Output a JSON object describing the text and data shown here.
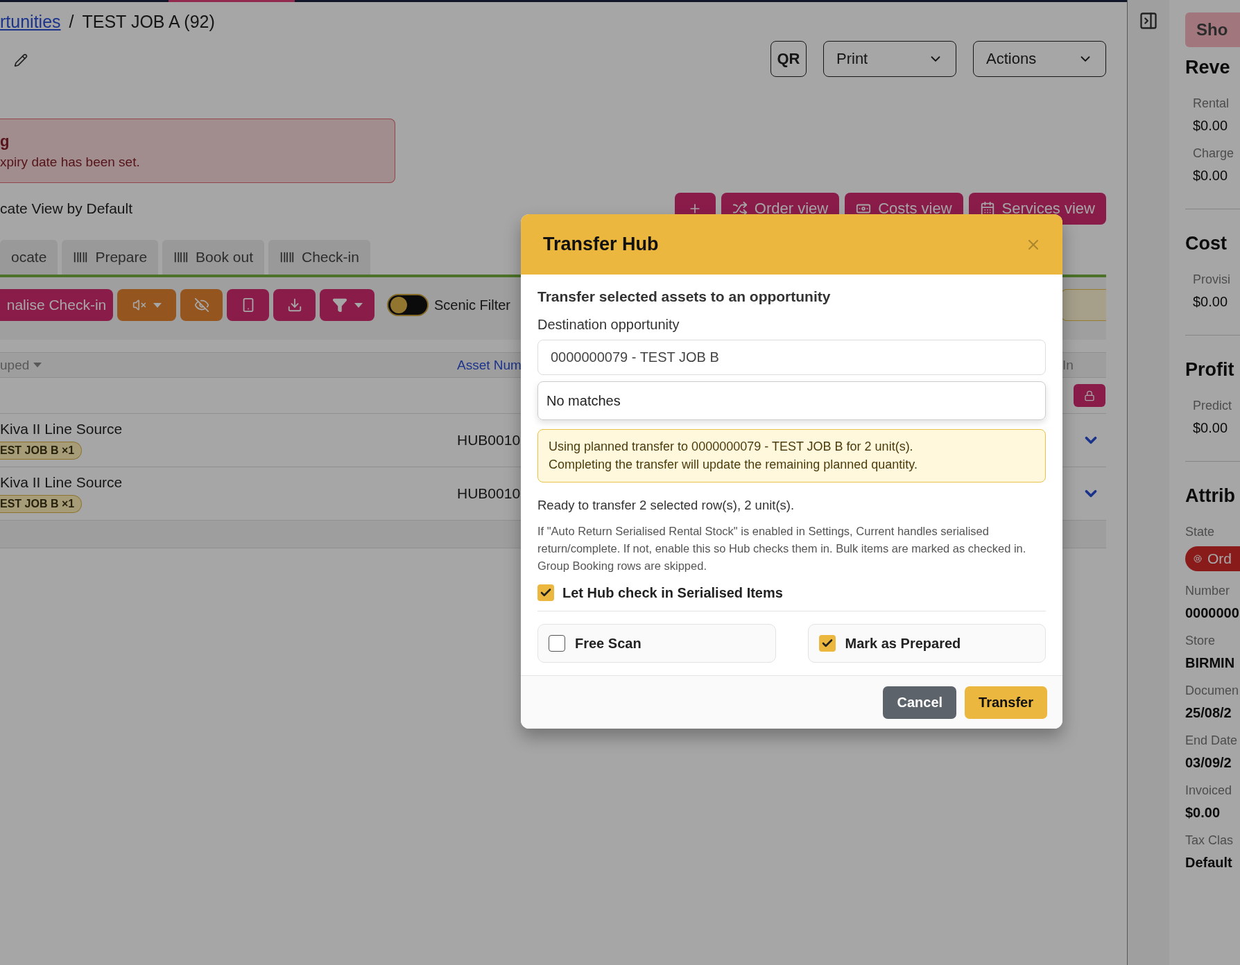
{
  "breadcrumb": {
    "link": "rtunities",
    "separator": "/",
    "current": "TEST JOB A (92)"
  },
  "header_actions": [
    {
      "label": "QR",
      "kind": "plain"
    },
    {
      "label": "Print",
      "kind": "dropdown"
    },
    {
      "label": "Actions",
      "kind": "dropdown"
    }
  ],
  "alert": {
    "title": "g",
    "message": "xpiry date has been set."
  },
  "default_view_label": "cate View by Default",
  "view_buttons": [
    {
      "label": "Order view"
    },
    {
      "label": "Costs view"
    },
    {
      "label": "Services view"
    }
  ],
  "tabs": [
    {
      "label": "ocate",
      "selected": false,
      "scan": false
    },
    {
      "label": "Prepare",
      "selected": false,
      "scan": true
    },
    {
      "label": "Book out",
      "selected": false,
      "scan": true
    },
    {
      "label": "Check-in",
      "selected": false,
      "scan": true
    }
  ],
  "toolbar": {
    "primary": "nalise Check-in",
    "toggle": {
      "label": "Scenic Filter",
      "on": false
    }
  },
  "table": {
    "columns": [
      "uped",
      "Asset Num",
      "In"
    ],
    "rows": [
      {
        "name": "Kiva II Line Source",
        "tag": "EST JOB B ×1",
        "asset": "HUB0010"
      },
      {
        "name": "Kiva II Line Source",
        "tag": "EST JOB B ×1",
        "asset": "HUB0010"
      }
    ]
  },
  "sidebar": {
    "button": "Sho",
    "sections": [
      {
        "title": "Reve",
        "fields": [
          {
            "label": "Rental",
            "value": "$0.00",
            "kind": "text"
          },
          {
            "label": "Charge",
            "value": "$0.00",
            "kind": "text"
          }
        ]
      },
      {
        "title": "Cost",
        "fields": [
          {
            "label": "Provisi",
            "value": "$0.00",
            "kind": "text"
          }
        ]
      },
      {
        "title": "Profit",
        "fields": [
          {
            "label": "Predict",
            "value": "$0.00",
            "kind": "text"
          }
        ]
      },
      {
        "title": "Attrib",
        "fields": [
          {
            "label": "State",
            "value": "Ord",
            "kind": "badge"
          },
          {
            "label": "Number",
            "value": "0000000",
            "kind": "strong"
          },
          {
            "label": "Store",
            "value": "BIRMIN",
            "kind": "strong"
          },
          {
            "label": "Documen",
            "value": "25/08/2",
            "kind": "strong"
          },
          {
            "label": "End Date",
            "value": "03/09/2",
            "kind": "strong"
          },
          {
            "label": "Invoiced",
            "value": "$0.00",
            "kind": "strong"
          },
          {
            "label": "Tax Clas",
            "value": "Default",
            "kind": "strong"
          }
        ]
      }
    ]
  },
  "modal": {
    "title": "Transfer Hub",
    "subtitle": "Transfer selected assets to an opportunity",
    "field_label": "Destination opportunity",
    "field_value": "0000000079 - TEST JOB B",
    "suggestion": "No matches",
    "notice_lines": [
      "Using planned transfer to 0000000079 - TEST JOB B for 2 unit(s).",
      "Completing the transfer will update the remaining planned quantity."
    ],
    "summary": "Ready to transfer 2 selected row(s), 2 unit(s).",
    "help": "If \"Auto Return Serialised Rental Stock\" is enabled in Settings, Current handles serialised return/complete. If not, enable this so Hub checks them in. Bulk items are marked as checked in. Group Booking rows are skipped.",
    "check_in_option": {
      "label": "Let Hub check in Serialised Items",
      "checked": true
    },
    "options": [
      {
        "label": "Free Scan",
        "checked": false
      },
      {
        "label": "Mark as Prepared",
        "checked": true
      }
    ],
    "buttons": [
      {
        "label": "Cancel",
        "kind": "secondary"
      },
      {
        "label": "Transfer",
        "kind": "primary"
      }
    ]
  }
}
